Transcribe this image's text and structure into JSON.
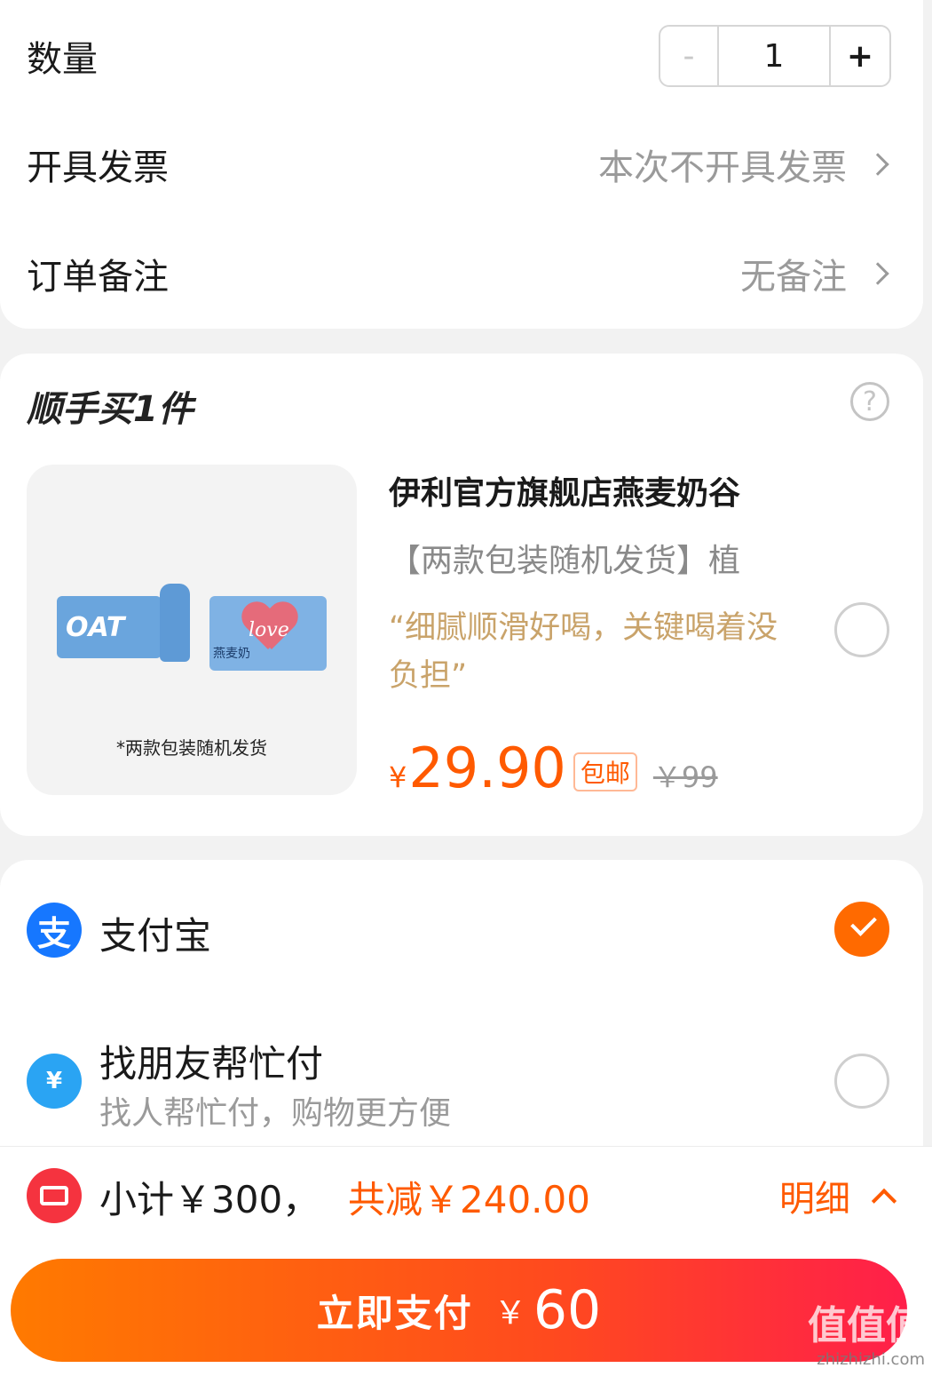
{
  "order": {
    "quantity_label": "数量",
    "quantity": {
      "minus": "-",
      "value": "1",
      "plus": "+"
    },
    "invoice_label": "开具发票",
    "invoice_value": "本次不开具发票",
    "note_label": "订单备注",
    "note_value": "无备注"
  },
  "addon": {
    "title": "顺手买1件",
    "help_icon": "question-circle-icon",
    "product": {
      "image_caption": "*两款包装随机发货",
      "image_text_oat": "OAT",
      "image_text_love": "love",
      "image_text_cn": "燕麦奶",
      "name": "伊利官方旗舰店燕麦奶谷",
      "subtitle": "【两款包装随机发货】植",
      "quote": "“细腻顺滑好喝，关键喝着没负担”",
      "currency": "¥",
      "price": "29.90",
      "tag": "包邮",
      "original_price": "￥99",
      "selected": false
    }
  },
  "payment": {
    "methods": [
      {
        "name": "支付宝",
        "icon": "alipay-icon",
        "icon_glyph": "支",
        "selected": true
      },
      {
        "name": "找朋友帮忙付",
        "subtitle": "找人帮忙付，购物更方便",
        "icon": "friend-pay-icon",
        "icon_glyph": "¥",
        "selected": false
      }
    ]
  },
  "summary": {
    "subtotal": "小计￥300，",
    "discount": "共减￥240.00",
    "detail_label": "明细",
    "pay_button_label": "立即支付",
    "pay_currency": "￥",
    "pay_amount": "60"
  },
  "watermark": {
    "big": "值值值",
    "small": "zhizhizhi.com"
  },
  "colors": {
    "accent": "#ff5a00",
    "alipay": "#1677ff",
    "quote": "#c9a36a",
    "coupon": "#f5333f"
  }
}
